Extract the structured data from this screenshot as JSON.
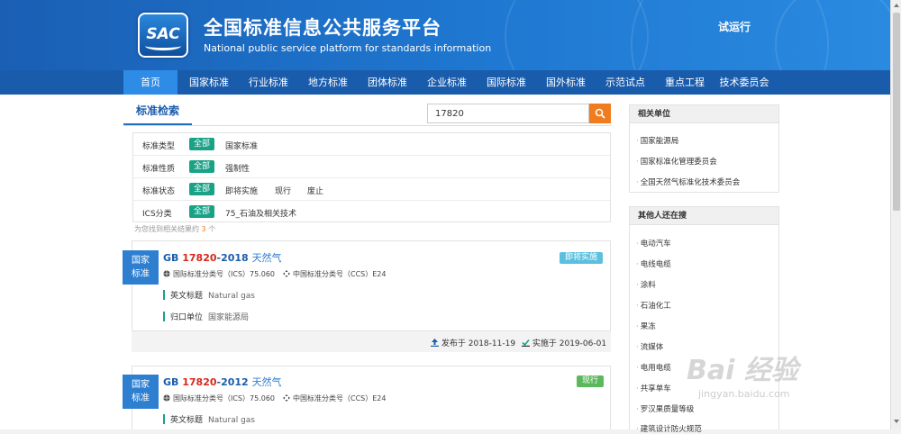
{
  "header": {
    "logo_text": "SAC",
    "title": "全国标准信息公共服务平台",
    "subtitle": "National public service platform  for standards information",
    "trial": "试运行"
  },
  "nav": [
    "首页",
    "国家标准",
    "行业标准",
    "地方标准",
    "团体标准",
    "企业标准",
    "国际标准",
    "国外标准",
    "示范试点",
    "重点工程",
    "技术委员会"
  ],
  "search": {
    "tab": "标准检索",
    "query": "17820"
  },
  "filters": [
    {
      "label": "标准类型",
      "all": "全部",
      "options": [
        "国家标准"
      ]
    },
    {
      "label": "标准性质",
      "all": "全部",
      "options": [
        "强制性"
      ]
    },
    {
      "label": "标准状态",
      "all": "全部",
      "options": [
        "即将实施",
        "现行",
        "废止"
      ]
    },
    {
      "label": "ICS分类",
      "all": "全部",
      "options": [
        "75_石油及相关技术"
      ]
    }
  ],
  "result_summary": {
    "prefix": "为您找到相关结果约",
    "count": "3",
    "suffix": "个"
  },
  "results": [
    {
      "badge_l1": "国家",
      "badge_l2": "标准",
      "prefix": "GB ",
      "code": "17820",
      "year": "-2018",
      "name": "天然气",
      "status": "即将实施",
      "status_color": "#5bc0de",
      "ics": "国际标准分类号（ICS）75.060",
      "ccs": "中国标准分类号（CCS）E24",
      "en_label": "英文标题",
      "en_value": "Natural gas",
      "dept_label": "归口单位",
      "dept_value": "国家能源局",
      "published": "发布于 2018-11-19",
      "effective": "实施于 2019-06-01"
    },
    {
      "badge_l1": "国家",
      "badge_l2": "标准",
      "prefix": "GB ",
      "code": "17820",
      "year": "-2012",
      "name": "天然气",
      "status": "现行",
      "status_color": "#5cb85c",
      "ics": "国际标准分类号（ICS）75.060",
      "ccs": "中国标准分类号（CCS）E24",
      "en_label": "英文标题",
      "en_value": "Natural gas"
    }
  ],
  "sidebar": {
    "related_title": "相关单位",
    "related": [
      "国家能源局",
      "国家标准化管理委员会",
      "全国天然气标准化技术委员会"
    ],
    "others_title": "其他人还在搜",
    "others": [
      "电动汽车",
      "电线电缆",
      "涂料",
      "石油化工",
      "果冻",
      "流媒体",
      "电用电缆",
      "共享单车",
      "罗汉果质量等级",
      "建筑设计防火规范"
    ]
  },
  "watermark": {
    "main": "Bai 经验",
    "sub": "jingyan.baidu.com"
  },
  "colors": {
    "nav_bg": "#1a5cac",
    "active_nav": "#2e8be6",
    "accent": "#1aa287",
    "search_btn": "#f07c1e"
  }
}
